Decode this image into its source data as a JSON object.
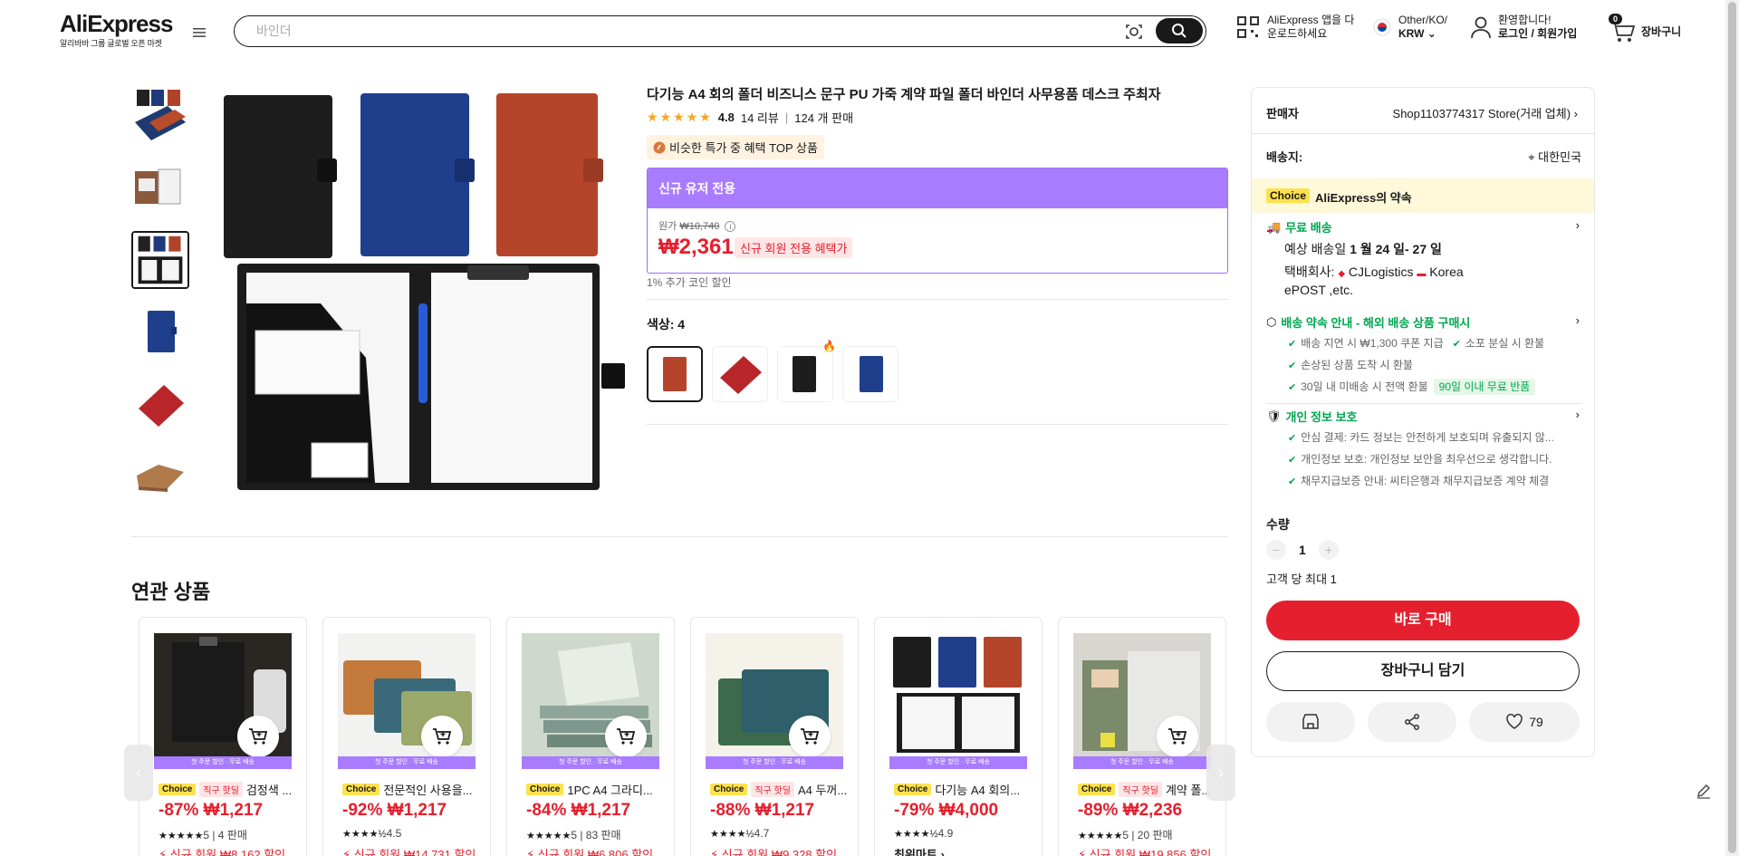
{
  "header": {
    "logo": "AliExpress",
    "logo_sub": "알리바바 그룹 글로벌 오픈 마켓",
    "search_placeholder": "바인더",
    "app_line1": "AliExpress 앱을 다",
    "app_line2": "운로드하세요",
    "locale_line1": "Other/KO/",
    "locale_line2": "KRW",
    "account_line1": "환영합니다!",
    "account_line2": "로그인 / 회원가입",
    "cart_count": "0",
    "cart_label": "장바구니"
  },
  "product": {
    "title": "다기능 A4 회의 폴더 비즈니스 문구 PU 가죽 계약 파일 폴더 바인더 사무용품 데스크 주최자",
    "rating": "4.8",
    "reviews": "14 리뷰",
    "sold": "124 개 판매",
    "top_badge": "비슷한 특가 중 혜택 TOP 상품",
    "promo_header": "신규 유저 전용",
    "orig_label": "원가",
    "orig_price": "₩10,740",
    "price": "₩2,361",
    "price_tag": "신규 회원 전용 혜택가",
    "coin_note": "1% 추가 코인 할인",
    "color_label": "색상: 4"
  },
  "related": {
    "title": "연관 상품",
    "band_text": "첫 주문 할인 · 무료 배송",
    "cards": [
      {
        "deal": "직구 핫딜",
        "name": "검정색 ...",
        "price": "-87% ₩1,217",
        "stars": "★★★★★",
        "rating": "5",
        "sold": "4 판매",
        "coupon": "신규 회원 ₩8,162 할인"
      },
      {
        "deal": "",
        "name": "전문적인 사용을...",
        "price": "-92% ₩1,217",
        "stars": "★★★★½",
        "rating": "4.5",
        "sold": "",
        "coupon": "신규 회원 ₩14,731 할인"
      },
      {
        "deal": "",
        "name": "1PC A4 그라디...",
        "price": "-84% ₩1,217",
        "stars": "★★★★★",
        "rating": "5",
        "sold": "83 판매",
        "coupon": "신규 회원 ₩6,806 할인"
      },
      {
        "deal": "",
        "name": "A4 두꺼...",
        "price": "-88% ₩1,217",
        "stars": "★★★★½",
        "rating": "4.7",
        "sold": "",
        "coupon": "신규 회원 ₩9,328 할인"
      },
      {
        "deal": "",
        "name": "다기능 A4 회의...",
        "price": "-79% ₩4,000",
        "stars": "★★★★½",
        "rating": "4.9",
        "sold": "",
        "coupon": "최위마트 ›"
      },
      {
        "deal": "직구 핫딜",
        "name": "계약 폴...",
        "price": "-89% ₩2,236",
        "stars": "★★★★★",
        "rating": "5",
        "sold": "20 판매",
        "coupon": "신규 회원 ₩19,856 할인"
      }
    ],
    "choice_label": "Choice",
    "card_deal_labels": [
      "직구 핫딜",
      "",
      "",
      "직구 핫딜",
      "",
      "직구 핫딜"
    ]
  },
  "panel": {
    "seller_label": "판매자",
    "seller_value": "Shop1103774317 Store(거래 업체)",
    "ship_to_label": "배송지:",
    "ship_to_value": "대한민국",
    "choice_label": "Choice",
    "promise": "AliExpress의 약속",
    "free_ship": "무료 배송",
    "eta_prefix": "예상 배송일",
    "eta": "1 월 24 일- 27 일",
    "carrier_label": "택배회사:",
    "carrier_value": "CJLogistics",
    "carrier_value2": "Korea",
    "carrier_value3": "ePOST ,etc.",
    "guarantee_title": "배송 약속 안내 - 해외 배송 상품 구매시",
    "guarantee_1": "배송 지연 시 ₩1,300 쿠폰 지급",
    "guarantee_1b": "소포 분실 시 환불",
    "guarantee_2": "손상된 상품 도착 시 환불",
    "guarantee_3": "30일 내 미배송 시 전액 환불",
    "return_pill": "90일 이내 무료 반품",
    "privacy_title": "개인 정보 보호",
    "privacy_1": "안심 결제: 카드 정보는 안전하게 보호되며 유출되지 않...",
    "privacy_2": "개인정보 보호: 개인정보 보안을 최우선으로 생각합니다.",
    "privacy_3": "채무지급보증 안내: 씨티은행과 채무지급보증 계약 체결",
    "qty_label": "수량",
    "qty_value": "1",
    "qty_limit": "고객 당 최대 1",
    "buy_now": "바로 구매",
    "add_cart": "장바구니 담기",
    "wishlist_count": "79"
  },
  "colors": {
    "accent_red": "#e5202e",
    "promo_purple": "#a97cff",
    "choice_yellow": "#ffe14d",
    "green": "#00a650"
  }
}
